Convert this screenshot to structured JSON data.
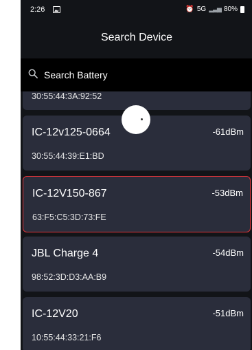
{
  "status_bar": {
    "time": "2:26",
    "network": "5G",
    "battery": "80%"
  },
  "header": {
    "title": "Search Device"
  },
  "search": {
    "placeholder": "Search Battery"
  },
  "partial_item": {
    "mac": "30:55:44:3A:92:52"
  },
  "devices": [
    {
      "name": "IC-12v125-0664",
      "rssi": "-61dBm",
      "mac": "30:55:44:39:E1:BD",
      "selected": false
    },
    {
      "name": "IC-12V150-867",
      "rssi": "-53dBm",
      "mac": "63:F5:C5:3D:73:FE",
      "selected": true
    },
    {
      "name": "JBL Charge 4",
      "rssi": "-54dBm",
      "mac": "98:52:3D:D3:AA:B9",
      "selected": false
    },
    {
      "name": "IC-12V20",
      "rssi": "-51dBm",
      "mac": "10:55:44:33:21:F6",
      "selected": false
    }
  ],
  "colors": {
    "background": "#121418",
    "card": "#2a2d3b",
    "selected_border": "#e0343a",
    "search_bar": "#000000"
  }
}
